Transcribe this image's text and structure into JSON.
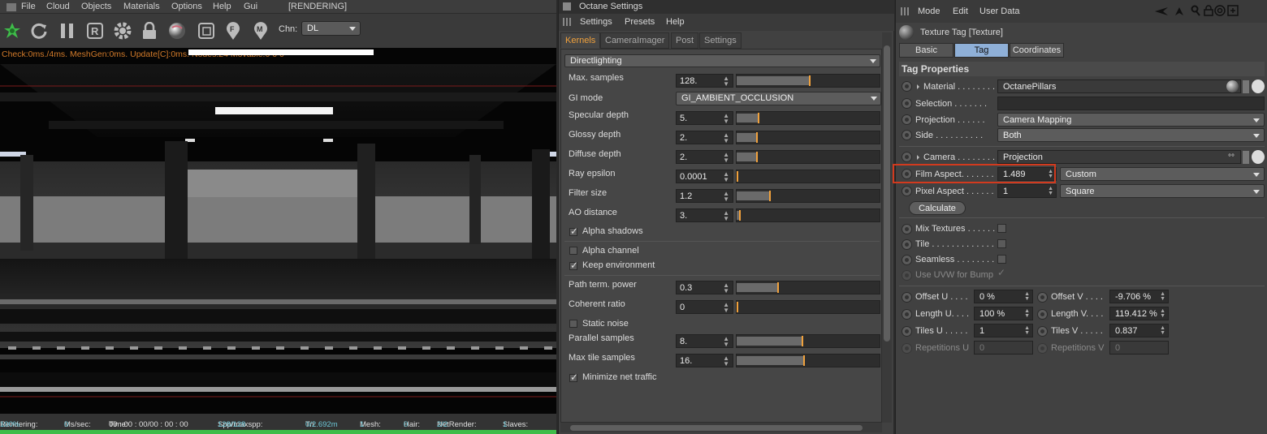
{
  "viewer": {
    "menu": [
      "File",
      "Cloud",
      "Objects",
      "Materials",
      "Options",
      "Help",
      "Gui",
      "[RENDERING]"
    ],
    "toolbar": {
      "icons": [
        "octane-logo-icon",
        "refresh-icon",
        "pause-icon",
        "region-render-icon",
        "settings-gear-icon",
        "lock-icon",
        "material-ball-icon",
        "clay-mode-icon",
        "focus-picker-icon",
        "material-picker-icon"
      ],
      "chn_label": "Chn:",
      "chn_value": "DL"
    },
    "status_line": "Check:0ms./4ms. MeshGen:0ms. Update[C]:0ms. Nodes:24 Movable:0  0 0",
    "bottom": {
      "rendering_label": "Rendering:",
      "rendering_value": "100%",
      "mssec_label": "Ms/sec:",
      "mssec_value": "0",
      "time_label": "Time:",
      "time_value": "00 : 00 : 00/00 : 00 : 00",
      "spp_label": "Spp/maxspp:",
      "spp_value": "128/128",
      "tri_label": "Tri:",
      "tri_value": "0/2.692m",
      "mesh_label": "Mesh:",
      "mesh_value": "1",
      "hair_label": "Hair:",
      "hair_value": "0",
      "net_label": "NetRender:",
      "net_value": "2/2",
      "slaves_label": "Slaves:",
      "slaves_value": "1"
    },
    "progress": 1.0
  },
  "octane": {
    "title": "Octane Settings",
    "menu": [
      "Settings",
      "Presets",
      "Help"
    ],
    "tabs": [
      "Kernels",
      "CameraImager",
      "Post",
      "Settings"
    ],
    "kernel": "Directlighting",
    "params": [
      {
        "label": "Max. samples",
        "value": "128.",
        "level": 0.51
      },
      {
        "label": "GI mode",
        "value": "GI_AMBIENT_OCCLUSION"
      },
      {
        "label": "Specular depth",
        "value": "5.",
        "level": 0.15
      },
      {
        "label": "Glossy depth",
        "value": "2.",
        "level": 0.14
      },
      {
        "label": "Diffuse depth",
        "value": "2.",
        "level": 0.14
      },
      {
        "label": "Ray epsilon",
        "value": "0.0001",
        "level": 0.0
      },
      {
        "label": "Filter size",
        "value": "1.2",
        "level": 0.23
      },
      {
        "label": "AO distance",
        "value": "3.",
        "level": 0.02
      }
    ],
    "checks": {
      "alpha_shadows": "Alpha shadows",
      "alpha_channel": "Alpha channel",
      "keep_environment": "Keep environment",
      "static_noise": "Static noise",
      "minimize_net": "Minimize net traffic"
    },
    "params2": [
      {
        "label": "Path term. power",
        "value": "0.3",
        "level": 0.29
      },
      {
        "label": "Coherent ratio",
        "value": "0",
        "level": 0.0
      }
    ],
    "params3": [
      {
        "label": "Parallel samples",
        "value": "8.",
        "level": 0.46
      },
      {
        "label": "Max tile samples",
        "value": "16.",
        "level": 0.47
      }
    ]
  },
  "attributes": {
    "menu": [
      "Mode",
      "Edit",
      "User Data"
    ],
    "tag_title": "Texture Tag [Texture]",
    "tabs": [
      "Basic",
      "Tag",
      "Coordinates"
    ],
    "section": "Tag Properties",
    "material_label": "Material . . . . . . . .",
    "material_value": "OctanePillars",
    "selection_label": "Selection . . . . . . .",
    "projection_label": "Projection . . . . . .",
    "projection_value": "Camera Mapping",
    "side_label": "Side . . . . . . . . . .",
    "side_value": "Both",
    "camera_label": "Camera . . . . . . . .",
    "camera_value": "Projection",
    "film_aspect_label": "Film Aspect. . . . . . .",
    "film_aspect_value": "1.489",
    "film_aspect_preset": "Custom",
    "pixel_aspect_label": "Pixel Aspect . . . . . .",
    "pixel_aspect_value": "1",
    "pixel_aspect_preset": "Square",
    "calculate": "Calculate",
    "mix_textures": "Mix Textures . . . . . .",
    "tile": "Tile . . . . . . . . . . . . .",
    "seamless": "Seamless . . . . . . . .",
    "use_uvw": "Use UVW for Bump",
    "offset_u_label": "Offset U . . . .",
    "offset_u": "0 %",
    "offset_v_label": "Offset V . . . .",
    "offset_v": "-9.706 %",
    "length_u_label": "Length U. . . .",
    "length_u": "100 %",
    "length_v_label": "Length V. . . .",
    "length_v": "119.412 %",
    "tiles_u_label": "Tiles U . . . . .",
    "tiles_u": "1",
    "tiles_v_label": "Tiles V . . . . .",
    "tiles_v": "0.837",
    "rep_u_label": "Repetitions U",
    "rep_u": "0",
    "rep_v_label": "Repetitions V",
    "rep_v": "0"
  },
  "colors": {
    "accent": "#f0a13c",
    "highlight": "#d23a1e",
    "tab_active": "#8fb0d8",
    "progress": "#3fbd4a"
  }
}
